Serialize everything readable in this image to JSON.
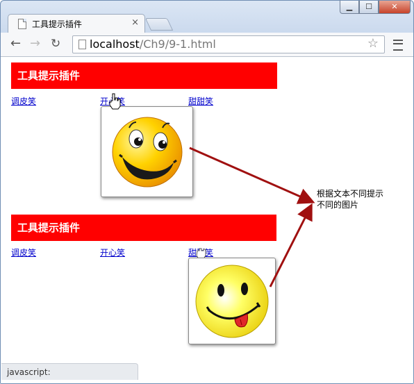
{
  "window": {
    "tab_title": "工具提示插件",
    "tab_close": "×",
    "minimize": "▁",
    "maximize": "☐",
    "close": "✕"
  },
  "toolbar": {
    "back": "←",
    "forward": "→",
    "reload": "↻",
    "url_host": "localhost",
    "url_path": "/Ch9/9-1.html",
    "bookmark_star": "☆"
  },
  "section1": {
    "header": "工具提示插件",
    "links": [
      "调皮笑",
      "开心笑",
      "甜甜笑"
    ]
  },
  "section2": {
    "header": "工具提示插件",
    "links": [
      "调皮笑",
      "开心笑",
      "甜甜笑"
    ]
  },
  "annotation": {
    "line1": "根据文本不同提示",
    "line2": "不同的图片"
  },
  "status_bar": "javascript:",
  "colors": {
    "header_bg": "#ff0000",
    "arrow": "#a01010",
    "link": "#0000cc"
  },
  "icons": {
    "page": "page-icon",
    "star": "star-icon",
    "menu": "menu-icon",
    "hand_cursor": "hand-cursor-icon"
  }
}
